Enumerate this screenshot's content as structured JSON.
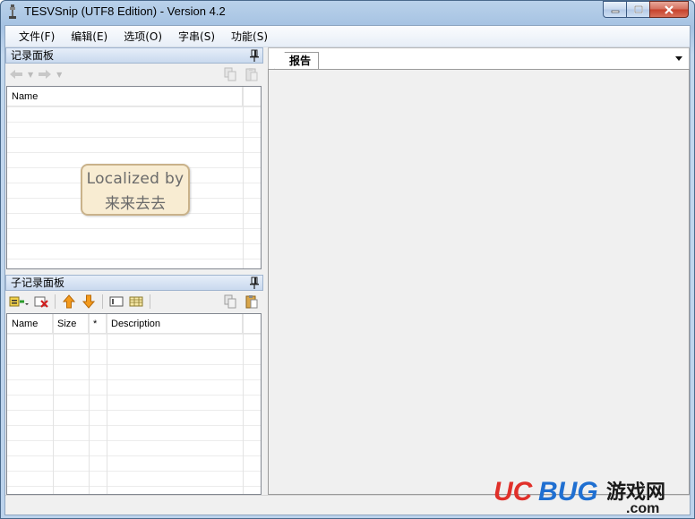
{
  "window": {
    "title": "TESVSnip (UTF8 Edition) - Version 4.2"
  },
  "menu": {
    "items": [
      "文件(F)",
      "编辑(E)",
      "选项(O)",
      "字串(S)",
      "功能(S)"
    ]
  },
  "record_pane": {
    "title": "记录面板",
    "columns": [
      "Name"
    ],
    "rows": []
  },
  "subrecord_pane": {
    "title": "子记录面板",
    "columns": [
      "Name",
      "Size",
      "*",
      "Description"
    ],
    "rows": []
  },
  "report": {
    "tab_label": "报告"
  },
  "watermark_badge": {
    "line1": "Localized by",
    "line2": "来来去去"
  },
  "site_logo": {
    "text_uc": "UC",
    "text_bug": "BUG",
    "text_cn": "游戏网",
    "text_com": ".com"
  },
  "colors": {
    "badge_bg": "#f8ecd2",
    "logo_red": "#e0302a",
    "logo_blue": "#1f6fd1"
  }
}
